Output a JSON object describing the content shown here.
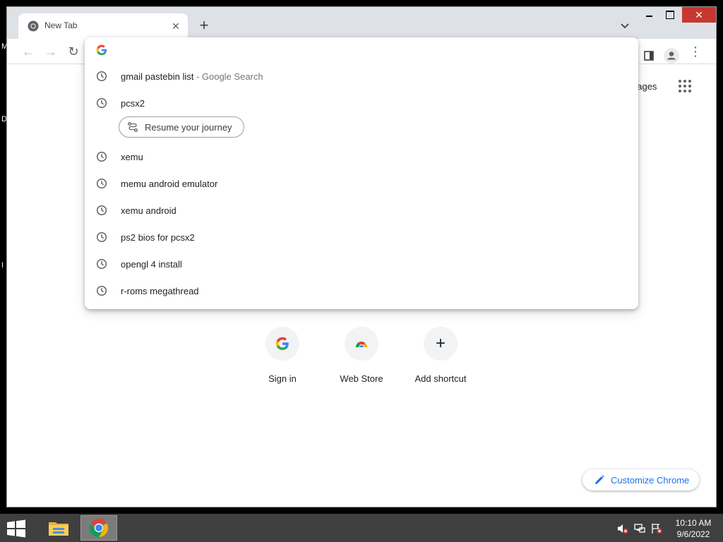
{
  "desktop": {
    "edge_letters": [
      "M",
      "D",
      "I"
    ]
  },
  "browser": {
    "tab": {
      "title": "New Tab",
      "close_symbol": "✕",
      "favicon": "chrome-icon"
    },
    "new_tab_symbol": "+",
    "tab_search_symbol": "⌄",
    "window_close_symbol": "✕",
    "toolbar": {
      "back": "←",
      "forward": "→",
      "reload": "↻",
      "menu": "⋮"
    }
  },
  "omnibox": {
    "input_value": "",
    "suggestions": [
      {
        "text": "gmail pastebin list",
        "suffix": " - Google Search",
        "icon": "clock-icon"
      },
      {
        "text": "pcsx2",
        "icon": "clock-icon"
      },
      {
        "text": "xemu",
        "icon": "clock-icon"
      },
      {
        "text": "memu android emulator",
        "icon": "clock-icon"
      },
      {
        "text": "xemu android",
        "icon": "clock-icon"
      },
      {
        "text": "ps2 bios for pcsx2",
        "icon": "clock-icon"
      },
      {
        "text": "opengl 4 install",
        "icon": "clock-icon"
      },
      {
        "text": "r-roms megathread",
        "icon": "clock-icon"
      }
    ],
    "journey_button": "Resume your journey"
  },
  "ntp": {
    "images_link": "nages",
    "shortcuts": [
      {
        "label": "Sign in",
        "icon": "google-g-icon"
      },
      {
        "label": "Web Store",
        "icon": "web-store-icon"
      },
      {
        "label": "Add shortcut",
        "icon": "plus-icon",
        "symbol": "+"
      }
    ],
    "customize_button": "Customize Chrome"
  },
  "taskbar": {
    "time": "10:10 AM",
    "date": "9/6/2022",
    "apps": [
      "file-explorer-icon",
      "chrome-icon"
    ]
  },
  "colors": {
    "accent": "#1a73e8",
    "tab_strip": "#dee1e6",
    "close_red": "#c7372f",
    "taskbar": "#3f3f3f"
  }
}
